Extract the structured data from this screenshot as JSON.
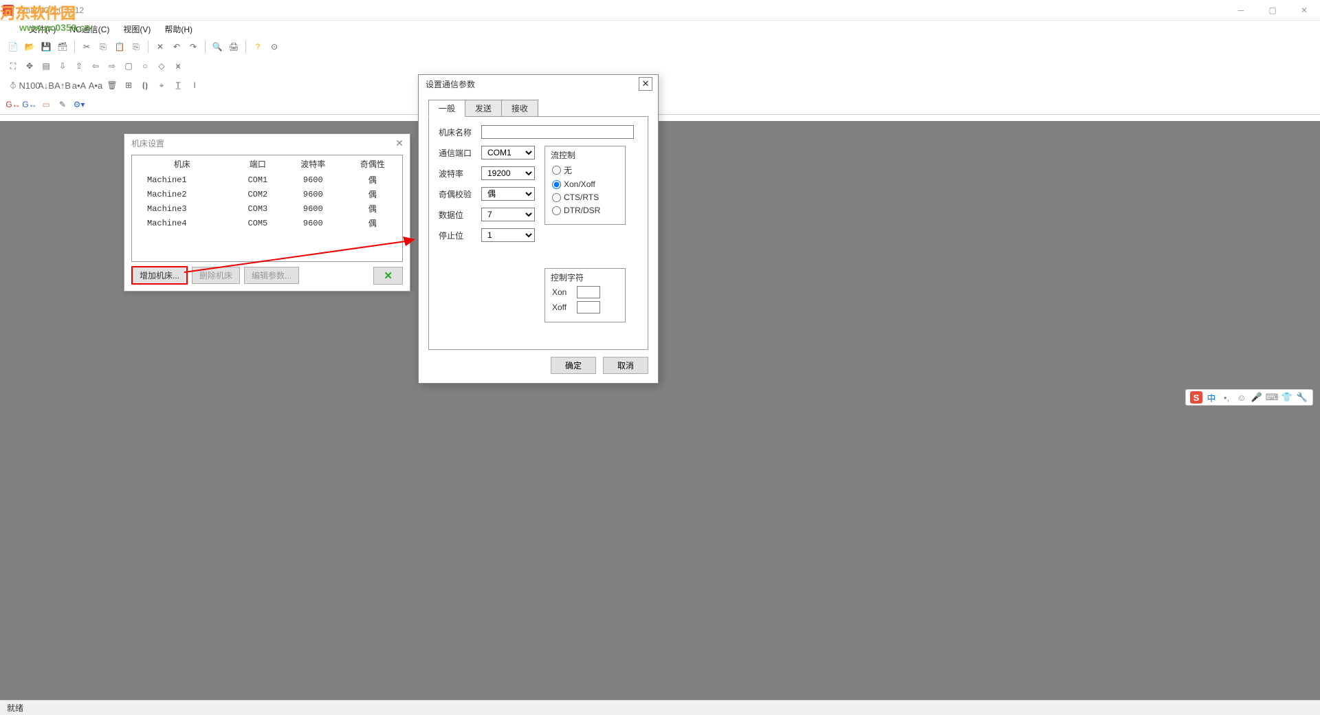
{
  "app": {
    "title": "SmarNC 1.0.1412"
  },
  "watermark": {
    "text": "河东软件园",
    "url": "www.pc0359.cn"
  },
  "menubar": [
    {
      "label": "文件(F)"
    },
    {
      "label": "NC通信(C)"
    },
    {
      "label": "视图(V)"
    },
    {
      "label": "帮助(H)"
    }
  ],
  "machine_dialog": {
    "title": "机床设置",
    "headers": [
      "机床",
      "端口",
      "波特率",
      "奇偶性"
    ],
    "rows": [
      [
        "Machine1",
        "COM1",
        "9600",
        "偶"
      ],
      [
        "Machine2",
        "COM2",
        "9600",
        "偶"
      ],
      [
        "Machine3",
        "COM3",
        "9600",
        "偶"
      ],
      [
        "Machine4",
        "COM5",
        "9600",
        "偶"
      ]
    ],
    "btn_add": "增加机床...",
    "btn_delete": "删除机床",
    "btn_edit": "编辑参数..."
  },
  "comm_dialog": {
    "title": "设置通信参数",
    "tabs": {
      "general": "一般",
      "send": "发送",
      "receive": "接收"
    },
    "labels": {
      "machine_name": "机床名称",
      "port": "通信端口",
      "baudrate": "波特率",
      "parity": "奇偶校验",
      "databits": "数据位",
      "stopbits": "停止位",
      "flow_control": "流控制",
      "control_chars": "控制字符",
      "xon": "Xon",
      "xoff": "Xoff"
    },
    "values": {
      "port": "COM1",
      "baudrate": "19200",
      "parity": "偶",
      "databits": "7",
      "stopbits": "1"
    },
    "flow_options": {
      "none": "无",
      "xonxoff": "Xon/Xoff",
      "ctsrts": "CTS/RTS",
      "dtrdsr": "DTR/DSR"
    },
    "btn_ok": "确定",
    "btn_cancel": "取消"
  },
  "statusbar": {
    "ready": "就绪"
  },
  "ime": {
    "cn": "中"
  }
}
